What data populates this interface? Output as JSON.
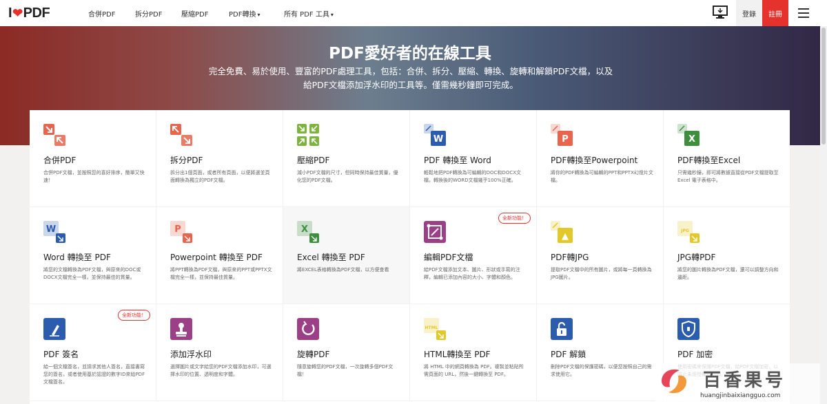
{
  "header": {
    "logo": {
      "left": "I",
      "right": "PDF",
      "heart": "❤"
    },
    "nav": [
      "合併PDF",
      "拆分PDF",
      "壓縮PDF",
      "PDF轉換",
      "所有 PDF 工具"
    ],
    "login": "登錄",
    "signup": "註冊"
  },
  "hero": {
    "title": "PDF愛好者的在線工具",
    "subtitle": "完全免費、易於使用、豐富的PDF處理工具，包括：合併、拆分、壓縮、轉換、旋轉和解鎖PDF文檔，以及給PDF文檔添加浮水印的工具等。僅需幾秒鐘即可完成。"
  },
  "tools": [
    {
      "title": "合併PDF",
      "desc": "合併PDF文檔，並按照您的喜好排序，簡單又快速！",
      "icon": "merge-icon",
      "color": "#e8644c"
    },
    {
      "title": "拆分PDF",
      "desc": "拆分出1個頁面，或者所有頁面，以便將選並頁面轉換為獨立的PDF文檔。",
      "icon": "split-icon",
      "color": "#e8644c"
    },
    {
      "title": "壓縮PDF",
      "desc": "減小PDF文檔的尺寸，但同時保持最佳質量，優化您的PDF文檔。",
      "icon": "compress-icon",
      "color": "#7fb340"
    },
    {
      "title": "PDF 轉換至 Word",
      "desc": "輕鬆地把PDF轉換為可編輯的DOC和DOCX文檔，轉換後的WORD文檔幾乎100%正確。",
      "icon": "pdf-to-word-icon",
      "color": "#2b5cad"
    },
    {
      "title": "PDF轉換至Powerpoint",
      "desc": "將你的PDF轉換為可編輯的PPT和PPTX幻燈片文檔。",
      "icon": "pdf-to-powerpoint-icon",
      "color": "#e8644c"
    },
    {
      "title": "PDF轉換至Excel",
      "desc": "只需幾秒鐘，即可將數據直接從PDF文檔提取至Excel 電子表格中。",
      "icon": "pdf-to-excel-icon",
      "color": "#3d8e3d"
    },
    {
      "title": "Word 轉換至 PDF",
      "desc": "將您的文檔轉換為PDF文檔，與原來的DOC或DOCX文檔完全一樣，並保持最佳的質量。",
      "icon": "word-to-pdf-icon",
      "color": "#2b5cad"
    },
    {
      "title": "Powerpoint 轉換至 PDF",
      "desc": "將PPT轉換為PDF文檔，與原來的PPT或PPTX文檔完全一樣，並保持最佳質量。",
      "icon": "powerpoint-to-pdf-icon",
      "color": "#e8644c"
    },
    {
      "title": "Excel 轉換至 PDF",
      "desc": "將EXCEL表格轉換為PDF文檔，以方便查看",
      "icon": "excel-to-pdf-icon",
      "color": "#3d8e3d"
    },
    {
      "title": "編輯PDF文檔",
      "desc": "給PDF文檔添加文本、圖片、形狀或手寫的注釋，編輯已添加內容的大小、字體和顏色。",
      "icon": "edit-pdf-icon",
      "color": "#9b3f86",
      "badge": "全新功能！"
    },
    {
      "title": "PDF轉JPG",
      "desc": "提取PDF文檔中的所有圖片，或將每一頁轉換為JPG圖片。",
      "icon": "pdf-to-jpg-icon",
      "color": "#e2c829"
    },
    {
      "title": "JPG轉PDF",
      "desc": "將您的圖片轉換為PDF文檔，還可以調整方向和邊距。",
      "icon": "jpg-to-pdf-icon",
      "color": "#e2c829"
    },
    {
      "title": "PDF 簽名",
      "desc": "給一個文檔簽名，並請求其他人簽名，直接書寫您的簽名，或者使用基於認證的數字ID來給PDF文檔簽名。",
      "icon": "sign-pdf-icon",
      "color": "#2b5cad",
      "badge": "全新功能！"
    },
    {
      "title": "添加浮水印",
      "desc": "選擇圖片或文字給您的PDF文檔添加水印，可選擇水印的位置、透明度和字體。",
      "icon": "watermark-icon",
      "color": "#9b3f86"
    },
    {
      "title": "旋轉PDF",
      "desc": "隨意旋轉您的PDF文檔，一次旋轉多個PDF文檔！",
      "icon": "rotate-pdf-icon",
      "color": "#9b3f86"
    },
    {
      "title": "HTML轉換至 PDF",
      "desc": "將 HTML 中的網頁轉換為 PDF。複製並粘貼所需頁面的 URL，然後一鍵轉換至 PDF。",
      "icon": "html-to-pdf-icon",
      "color": "#e2c829"
    },
    {
      "title": "PDF 解鎖",
      "desc": "刪除PDF文檔的保護密碼，以便您按照自己的需求使用它。",
      "icon": "unlock-pdf-icon",
      "color": "#2b5cad"
    },
    {
      "title": "PDF 加密",
      "desc": "使用密碼來保護PDF文檔，給PDF文檔加密，以防止未經授權的訪問。",
      "icon": "protect-pdf-icon",
      "color": "#2b5cad"
    }
  ],
  "watermark": {
    "brand": "百香果号",
    "url": "huangjinbaixiangguo.com"
  }
}
